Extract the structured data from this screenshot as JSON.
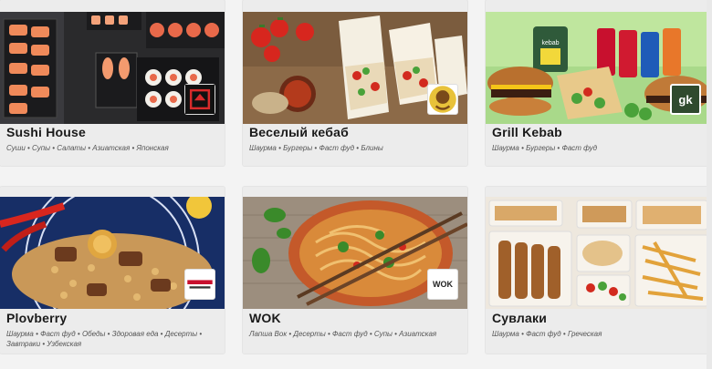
{
  "restaurants": [
    {
      "name": "Sushi House",
      "tags": "Суши • Супы • Салаты • Азиатская • Японская",
      "logo_icon": "sushi-house-logo",
      "colors": {
        "bg": "#2c2c2e",
        "accent": "#f07a4a",
        "logo_bg": "#ffffff"
      }
    },
    {
      "name": "Веселый кебаб",
      "tags": "Шаурма • Бургеры • Фаст фуд • Блины",
      "logo_icon": "veselyy-kebab-logo",
      "colors": {
        "bg": "#8a6a4a",
        "accent": "#d8382b",
        "logo_bg": "#ffffff"
      }
    },
    {
      "name": "Grill Kebab",
      "tags": "Шаурма • Бургеры • Фаст фуд",
      "logo_icon": "grill-kebab-logo",
      "logo_text": "gk",
      "colors": {
        "bg": "#9fd07a",
        "accent": "#c8102e",
        "logo_bg": "#2f4a2e"
      }
    },
    {
      "name": "Plovberry",
      "tags": "Шаурма • Фаст фуд • Обеды • Здоровая еда • Десерты • Завтраки • Узбекская",
      "logo_icon": "plovberry-logo",
      "colors": {
        "bg": "#1c3a7a",
        "accent": "#d9a441",
        "logo_bg": "#ffffff"
      }
    },
    {
      "name": "WOK",
      "tags": "Лапша Вок • Десерты • Фаст фуд • Супы • Азиатская",
      "logo_icon": "wok-logo",
      "logo_text": "WOK",
      "colors": {
        "bg": "#9a8a78",
        "accent": "#c85a2a",
        "logo_bg": "#ffffff"
      }
    },
    {
      "name": "Сувлаки",
      "tags": "Шаурма • Фаст фуд • Греческая",
      "logo_icon": "suvlaki-logo",
      "colors": {
        "bg": "#e8e2d8",
        "accent": "#c08040",
        "logo_bg": "#ffffff"
      }
    }
  ]
}
